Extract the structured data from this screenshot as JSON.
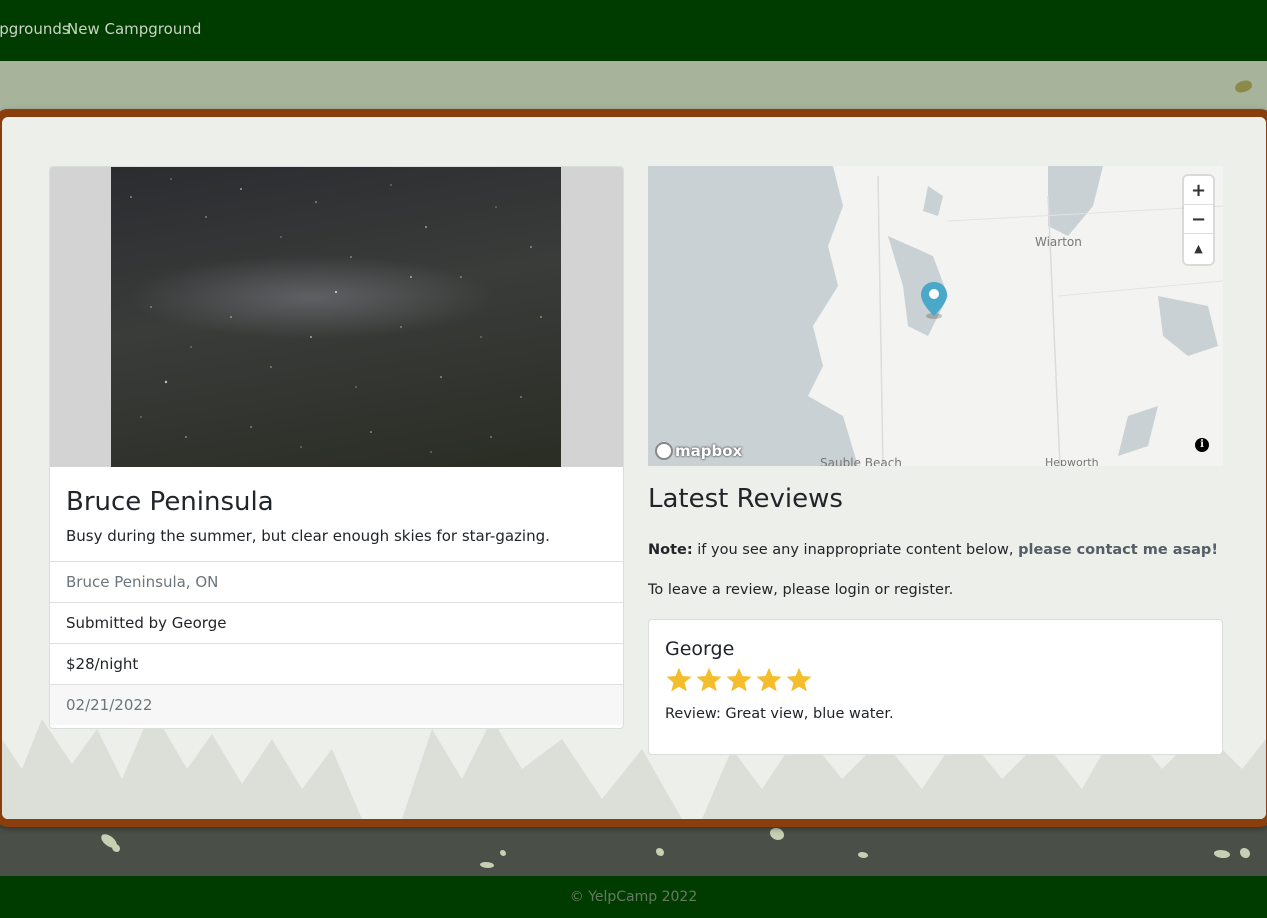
{
  "nav": {
    "items": [
      {
        "label": "Campgrounds"
      },
      {
        "label": "New Campground"
      }
    ]
  },
  "campground": {
    "title": "Bruce Peninsula",
    "description": "Busy during the summer, but clear enough skies for star-gazing.",
    "location": "Bruce Peninsula, ON",
    "submitted_by": "Submitted by George",
    "price": "$28/night",
    "date": "02/21/2022"
  },
  "map": {
    "labels": {
      "wiarton": "Wiarton",
      "sauble": "Sauble Beach",
      "hepworth": "Hepworth"
    },
    "zoom_in": "+",
    "zoom_out": "−",
    "compass": "▲",
    "brand": "mapbox",
    "info": "i",
    "marker_color": "#4aa8c8"
  },
  "reviews": {
    "title": "Latest Reviews",
    "note_label": "Note:",
    "note_text": " if you see any inappropriate content below, ",
    "contact_text": "please contact me asap!",
    "leave_text": "To leave a review, please login or register.",
    "items": [
      {
        "author": "George",
        "rating": 5,
        "text": "Review: Great view, blue water."
      }
    ]
  },
  "footer": {
    "copyright": "© YelpCamp 2022"
  },
  "colors": {
    "nav": "#003b00",
    "panel_border": "#8a3e0e",
    "star": "#f5bd2b"
  }
}
